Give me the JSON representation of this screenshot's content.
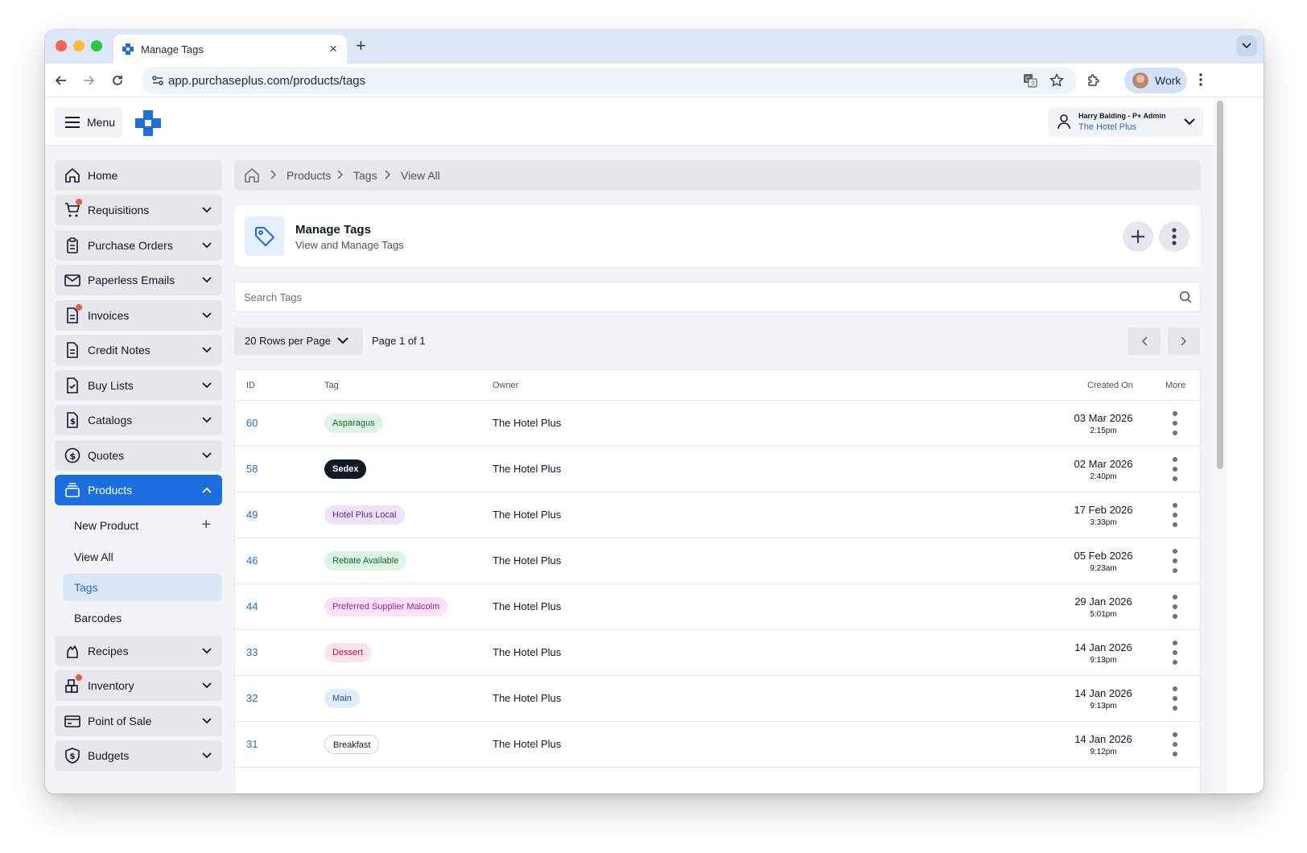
{
  "browser": {
    "tab_title": "Manage Tags",
    "url": "app.purchaseplus.com/products/tags",
    "profile": "Work"
  },
  "header": {
    "menu_label": "Menu",
    "user_name": "Harry Balding - P+ Admin",
    "user_org": "The Hotel Plus"
  },
  "sidebar": {
    "items": [
      {
        "label": "Home",
        "icon": "home-icon"
      },
      {
        "label": "Requisitions",
        "icon": "cart-icon",
        "alert": true
      },
      {
        "label": "Purchase Orders",
        "icon": "clipboard-icon"
      },
      {
        "label": "Paperless Emails",
        "icon": "mail-icon"
      },
      {
        "label": "Invoices",
        "icon": "invoice-icon",
        "alert": true
      },
      {
        "label": "Credit Notes",
        "icon": "document-icon"
      },
      {
        "label": "Buy Lists",
        "icon": "checklist-icon"
      },
      {
        "label": "Catalogs",
        "icon": "dollar-document-icon"
      },
      {
        "label": "Quotes",
        "icon": "dollar-circle-icon"
      },
      {
        "label": "Products",
        "icon": "stack-icon",
        "active": true
      },
      {
        "label": "Recipes",
        "icon": "flame-icon"
      },
      {
        "label": "Inventory",
        "icon": "boxes-icon",
        "alert": true
      },
      {
        "label": "Point of Sale",
        "icon": "card-icon"
      },
      {
        "label": "Budgets",
        "icon": "shield-dollar-icon"
      }
    ],
    "products_sub": [
      {
        "label": "New Product"
      },
      {
        "label": "View All"
      },
      {
        "label": "Tags",
        "active": true
      },
      {
        "label": "Barcodes"
      }
    ]
  },
  "breadcrumb": [
    "Products",
    "Tags",
    "View All"
  ],
  "page": {
    "title": "Manage Tags",
    "subtitle": "View and Manage Tags"
  },
  "search": {
    "placeholder": "Search Tags"
  },
  "pagination": {
    "rows_label": "20 Rows per Page",
    "page_info": "Page 1 of 1"
  },
  "table": {
    "columns": [
      "ID",
      "Tag",
      "Owner",
      "Created On",
      "More"
    ],
    "rows": [
      {
        "id": "60",
        "tag": "Asparagus",
        "tag_bg": "#dcf5e7",
        "tag_fg": "#166534",
        "owner": "The Hotel Plus",
        "date": "03 Mar 2026",
        "time": "2:15pm"
      },
      {
        "id": "58",
        "tag": "Sedex",
        "tag_bg": "#111827",
        "tag_fg": "#ffffff",
        "owner": "The Hotel Plus",
        "date": "02 Mar 2026",
        "time": "2:40pm"
      },
      {
        "id": "49",
        "tag": "Hotel Plus Local",
        "tag_bg": "#ede4fb",
        "tag_fg": "#6b21a8",
        "owner": "The Hotel Plus",
        "date": "17 Feb 2026",
        "time": "3:33pm"
      },
      {
        "id": "46",
        "tag": "Rebate Available",
        "tag_bg": "#dcf5e7",
        "tag_fg": "#166534",
        "owner": "The Hotel Plus",
        "date": "05 Feb 2026",
        "time": "9:23am"
      },
      {
        "id": "44",
        "tag": "Preferred Supplier Malcolm",
        "tag_bg": "#fbe3f6",
        "tag_fg": "#a21caf",
        "owner": "The Hotel Plus",
        "date": "29 Jan 2026",
        "time": "5:01pm"
      },
      {
        "id": "33",
        "tag": "Dessert",
        "tag_bg": "#fde4ec",
        "tag_fg": "#be123c",
        "owner": "The Hotel Plus",
        "date": "14 Jan 2026",
        "time": "9:13pm"
      },
      {
        "id": "32",
        "tag": "Main",
        "tag_bg": "#e0edfb",
        "tag_fg": "#1d4ed8",
        "owner": "The Hotel Plus",
        "date": "14 Jan 2026",
        "time": "9:13pm"
      },
      {
        "id": "31",
        "tag": "Breakfast",
        "tag_bg": "#ffffff",
        "tag_fg": "#111827",
        "owner": "The Hotel Plus",
        "date": "14 Jan 2026",
        "time": "9:12pm"
      }
    ]
  },
  "colors": {
    "accent": "#1d6fe0",
    "alert": "#ef5a45"
  }
}
